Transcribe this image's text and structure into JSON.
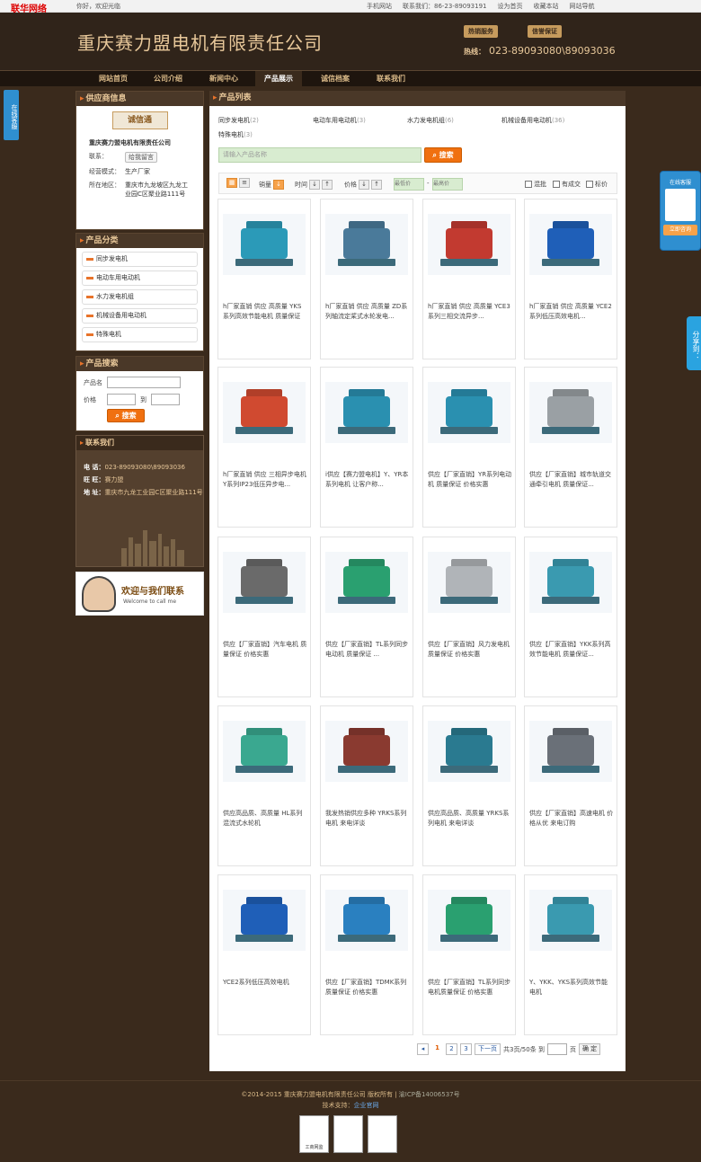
{
  "topbar": {
    "brand": "联华网络",
    "greeting": "你好，欢迎光临",
    "links": [
      "手机网站",
      "联系我们：86-23-89093191",
      "设为首页",
      "收藏本站",
      "网站导航"
    ]
  },
  "header": {
    "company": "重庆赛力盟电机有限责任公司",
    "badge_hot": "热销服务",
    "badge_trust": "信誉保证",
    "hotline_label": "热线：",
    "hotline": "023-89093080\\89093036"
  },
  "nav": {
    "items": [
      "网站首页",
      "公司介绍",
      "新闻中心",
      "产品展示",
      "诚信档案",
      "联系我们"
    ],
    "active": 3
  },
  "side_tab": "在线客服",
  "supplier": {
    "title": "供应商信息",
    "logo": "诚信通",
    "name": "重庆赛力盟电机有限责任公司",
    "contact_label": "联系：",
    "msg_btn": "给我留言",
    "mode_label": "经营模式：",
    "mode": "生产厂家",
    "area_label": "所在地区：",
    "area": "重庆市九龙坡区九龙工业园C区聚业路111号"
  },
  "categories": {
    "title": "产品分类",
    "items": [
      "同步发电机",
      "电动车用电动机",
      "水力发电机组",
      "机械设备用电动机",
      "特殊电机"
    ]
  },
  "search": {
    "title": "产品搜索",
    "name_label": "产品名",
    "price_label": "价格",
    "to": "到",
    "button": "搜索"
  },
  "contact": {
    "title": "联系我们",
    "tel_label": "电 话：",
    "tel": "023-89093080\\89093036",
    "ww_label": "旺 旺：",
    "ww": "赛力盟",
    "addr_label": "地 址：",
    "addr": "重庆市九龙工业园C区聚业路111号"
  },
  "welcome": {
    "cn": "欢迎与我们联系",
    "en": "Welcome to call me"
  },
  "main": {
    "title": "产品列表",
    "tags": [
      {
        "name": "同步发电机",
        "count": "(2)"
      },
      {
        "name": "电动车用电动机",
        "count": "(3)"
      },
      {
        "name": "水力发电机组",
        "count": "(6)"
      },
      {
        "name": "机械设备用电动机",
        "count": "(36)"
      },
      {
        "name": "特殊电机",
        "count": "(3)"
      }
    ],
    "search_placeholder": "请输入产品名称",
    "search_button": "搜索",
    "sort": {
      "sales": "销量",
      "time": "时间",
      "price": "价格",
      "min_placeholder": "最低价",
      "max_placeholder": "最高价",
      "dash": "-",
      "checks": [
        "混批",
        "有成交",
        "标价"
      ]
    }
  },
  "products": [
    {
      "caption": "h厂家直销 供应 高质量 YKS系列高效节能电机 质量保证",
      "color": "#2b9ab8"
    },
    {
      "caption": "h厂家直销 供应 高质量 ZD系列轴流定桨式水轮发电...",
      "color": "#4a7a9a"
    },
    {
      "caption": "h厂家直销 供应 高质量 YCE3系列三相交流异步...",
      "color": "#c23a30"
    },
    {
      "caption": "h厂家直销 供应 高质量 YCE2系列低压高效电机...",
      "color": "#1f5fb8"
    },
    {
      "caption": "h厂家直销 供应 三相异步电机 Y系列IP23低压异步电...",
      "color": "#d04a30"
    },
    {
      "caption": "i供应【赛力盟电机】Y、YR本系列电机 让客户称...",
      "color": "#2a90b0"
    },
    {
      "caption": "供应【厂家直销】YR系列电动机 质量保证 价格实惠",
      "color": "#2a90b0"
    },
    {
      "caption": "供应【厂家直销】城市轨道交通牵引电机 质量保证...",
      "color": "#9aa0a4"
    },
    {
      "caption": "供应【厂家直销】汽车电机 质量保证 价格实惠",
      "color": "#6a6a6a"
    },
    {
      "caption": "供应【厂家直销】TL系列同步电动机 质量保证 ...",
      "color": "#2aa070"
    },
    {
      "caption": "供应【厂家直销】风力发电机 质量保证 价格实惠",
      "color": "#b0b4b8"
    },
    {
      "caption": "供应【厂家直销】YKK系列高效节能电机 质量保证...",
      "color": "#3a9ab0"
    },
    {
      "caption": "供应高品质、高质量 HL系列混流式水轮机",
      "color": "#3aa890"
    },
    {
      "caption": "我发热销供应多种 YRKS系列电机 来电详谈",
      "color": "#8a3a30"
    },
    {
      "caption": "供应高品质、高质量 YRKS系列电机 来电详谈",
      "color": "#2a7a90"
    },
    {
      "caption": "供应【厂家直销】高速电机 价格从优 来电订购",
      "color": "#6a7078"
    },
    {
      "caption": "YCE2系列低压高效电机",
      "color": "#1f5fb8"
    },
    {
      "caption": "供应【厂家直销】TDMK系列质量保证 价格实惠",
      "color": "#2a80c0"
    },
    {
      "caption": "供应【厂家直销】TL系列同步电机质量保证 价格实惠",
      "color": "#2aa070"
    },
    {
      "caption": "Y、YKK、YKS系列高效节能电机",
      "color": "#3a9ab0"
    }
  ],
  "pager": {
    "pages": [
      "1",
      "2",
      "3"
    ],
    "next": "下一页",
    "total": "共3页/50条 到",
    "page_unit": "页",
    "ok": "确 定"
  },
  "footer": {
    "copyright": "©2014-2015 重庆赛力盟电机有限责任公司 版权所有",
    "icp": "渝ICP备14006537号",
    "support_label": "技术支持：",
    "support": "企业官网",
    "badges": [
      "工商网监",
      "",
      ""
    ]
  },
  "float": {
    "title": "在线客服",
    "button": "立即咨询"
  },
  "share": "分享到："
}
